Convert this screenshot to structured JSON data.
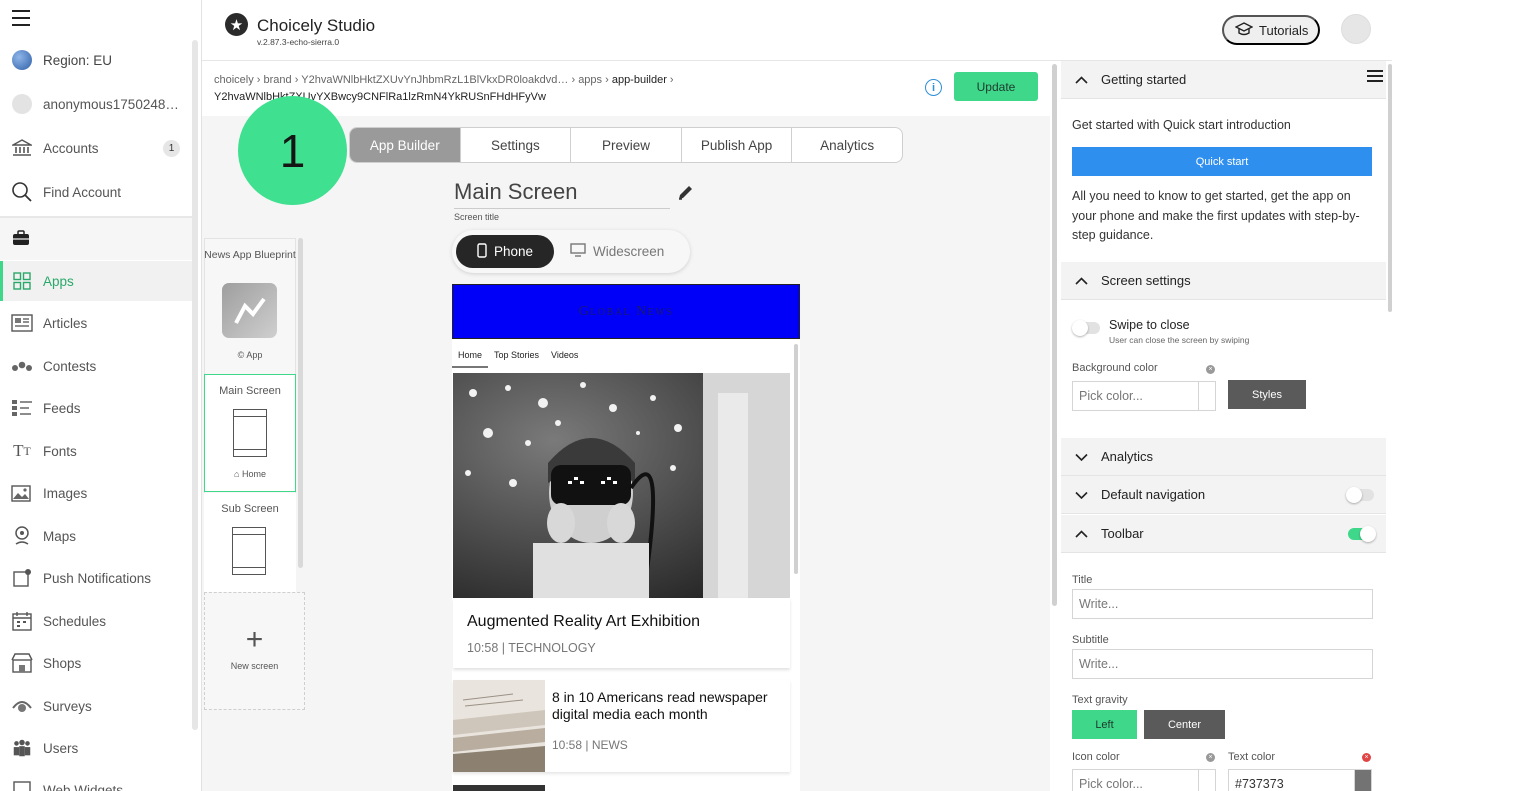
{
  "sidebar": {
    "region": "Region: EU",
    "user": "anonymous1750248…",
    "accounts": "Accounts",
    "accounts_badge": "1",
    "find_account": "Find Account",
    "items": [
      {
        "label": "Apps",
        "icon": "grid-icon"
      },
      {
        "label": "Articles",
        "icon": "article-icon"
      },
      {
        "label": "Contests",
        "icon": "contests-icon"
      },
      {
        "label": "Feeds",
        "icon": "feeds-icon"
      },
      {
        "label": "Fonts",
        "icon": "fonts-icon"
      },
      {
        "label": "Images",
        "icon": "images-icon"
      },
      {
        "label": "Maps",
        "icon": "map-pin-icon"
      },
      {
        "label": "Push Notifications",
        "icon": "notification-icon"
      },
      {
        "label": "Schedules",
        "icon": "calendar-icon"
      },
      {
        "label": "Shops",
        "icon": "shop-icon"
      },
      {
        "label": "Surveys",
        "icon": "survey-icon"
      },
      {
        "label": "Users",
        "icon": "users-icon"
      },
      {
        "label": "Web Widgets",
        "icon": "widget-icon"
      }
    ]
  },
  "header": {
    "title": "Choicely Studio",
    "version": "v.2.87.3-echo-sierra.0",
    "tutorials": "Tutorials"
  },
  "breadcrumb": {
    "c1": "choicely",
    "c2": "brand",
    "c3": "Y2hvaWNlbHktZXUvYnJhbmRzL1BlVkxDR0loakdvd…",
    "c4": "apps",
    "c5": "app-builder",
    "id": "Y2hvaWNlbHktZXUvYXBwcy9CNFlRa1lzRmN4YkRUSnFHdHFyVw"
  },
  "update_label": "Update",
  "tutorial_step": "1",
  "tabs": [
    "App Builder",
    "Settings",
    "Preview",
    "Publish App",
    "Analytics"
  ],
  "screen": {
    "title": "Main Screen",
    "title_label": "Screen title",
    "device_phone": "Phone",
    "device_wide": "Widescreen"
  },
  "screens": {
    "blueprint": "News App Blueprint",
    "app_label": "App",
    "main_name": "Main Screen",
    "main_tag": "Home",
    "sub_name": "Sub Screen",
    "new_screen": "New screen"
  },
  "preview": {
    "banner": "Global News",
    "nav": [
      "Home",
      "Top Stories",
      "Videos"
    ],
    "article1_title": "Augmented Reality Art Exhibition",
    "article1_meta": "10:58 | TECHNOLOGY",
    "article2_title": "8 in 10 Americans read newspaper digital media each month",
    "article2_meta": "10:58 | NEWS"
  },
  "right_panel": {
    "getting_started": "Getting started",
    "intro": "Get started with Quick start introduction",
    "quick_start": "Quick start",
    "desc": "All you need to know to get started, get the app on your phone and make the first updates with step-by-step guidance.",
    "screen_settings": "Screen settings",
    "swipe_title": "Swipe to close",
    "swipe_sub": "User can close the screen by swiping",
    "bg_color_label": "Background color",
    "pick_color": "Pick color...",
    "styles": "Styles",
    "analytics": "Analytics",
    "default_nav": "Default navigation",
    "toolbar": "Toolbar",
    "title_label": "Title",
    "title_placeholder": "Write...",
    "subtitle_label": "Subtitle",
    "subtitle_placeholder": "Write...",
    "text_gravity": "Text gravity",
    "left": "Left",
    "center": "Center",
    "icon_color": "Icon color",
    "text_color": "Text color",
    "text_color_value": "#737373"
  },
  "colors": {
    "accent": "#3fd78a",
    "primary": "#2f8fef",
    "banner": "#0000f8"
  }
}
